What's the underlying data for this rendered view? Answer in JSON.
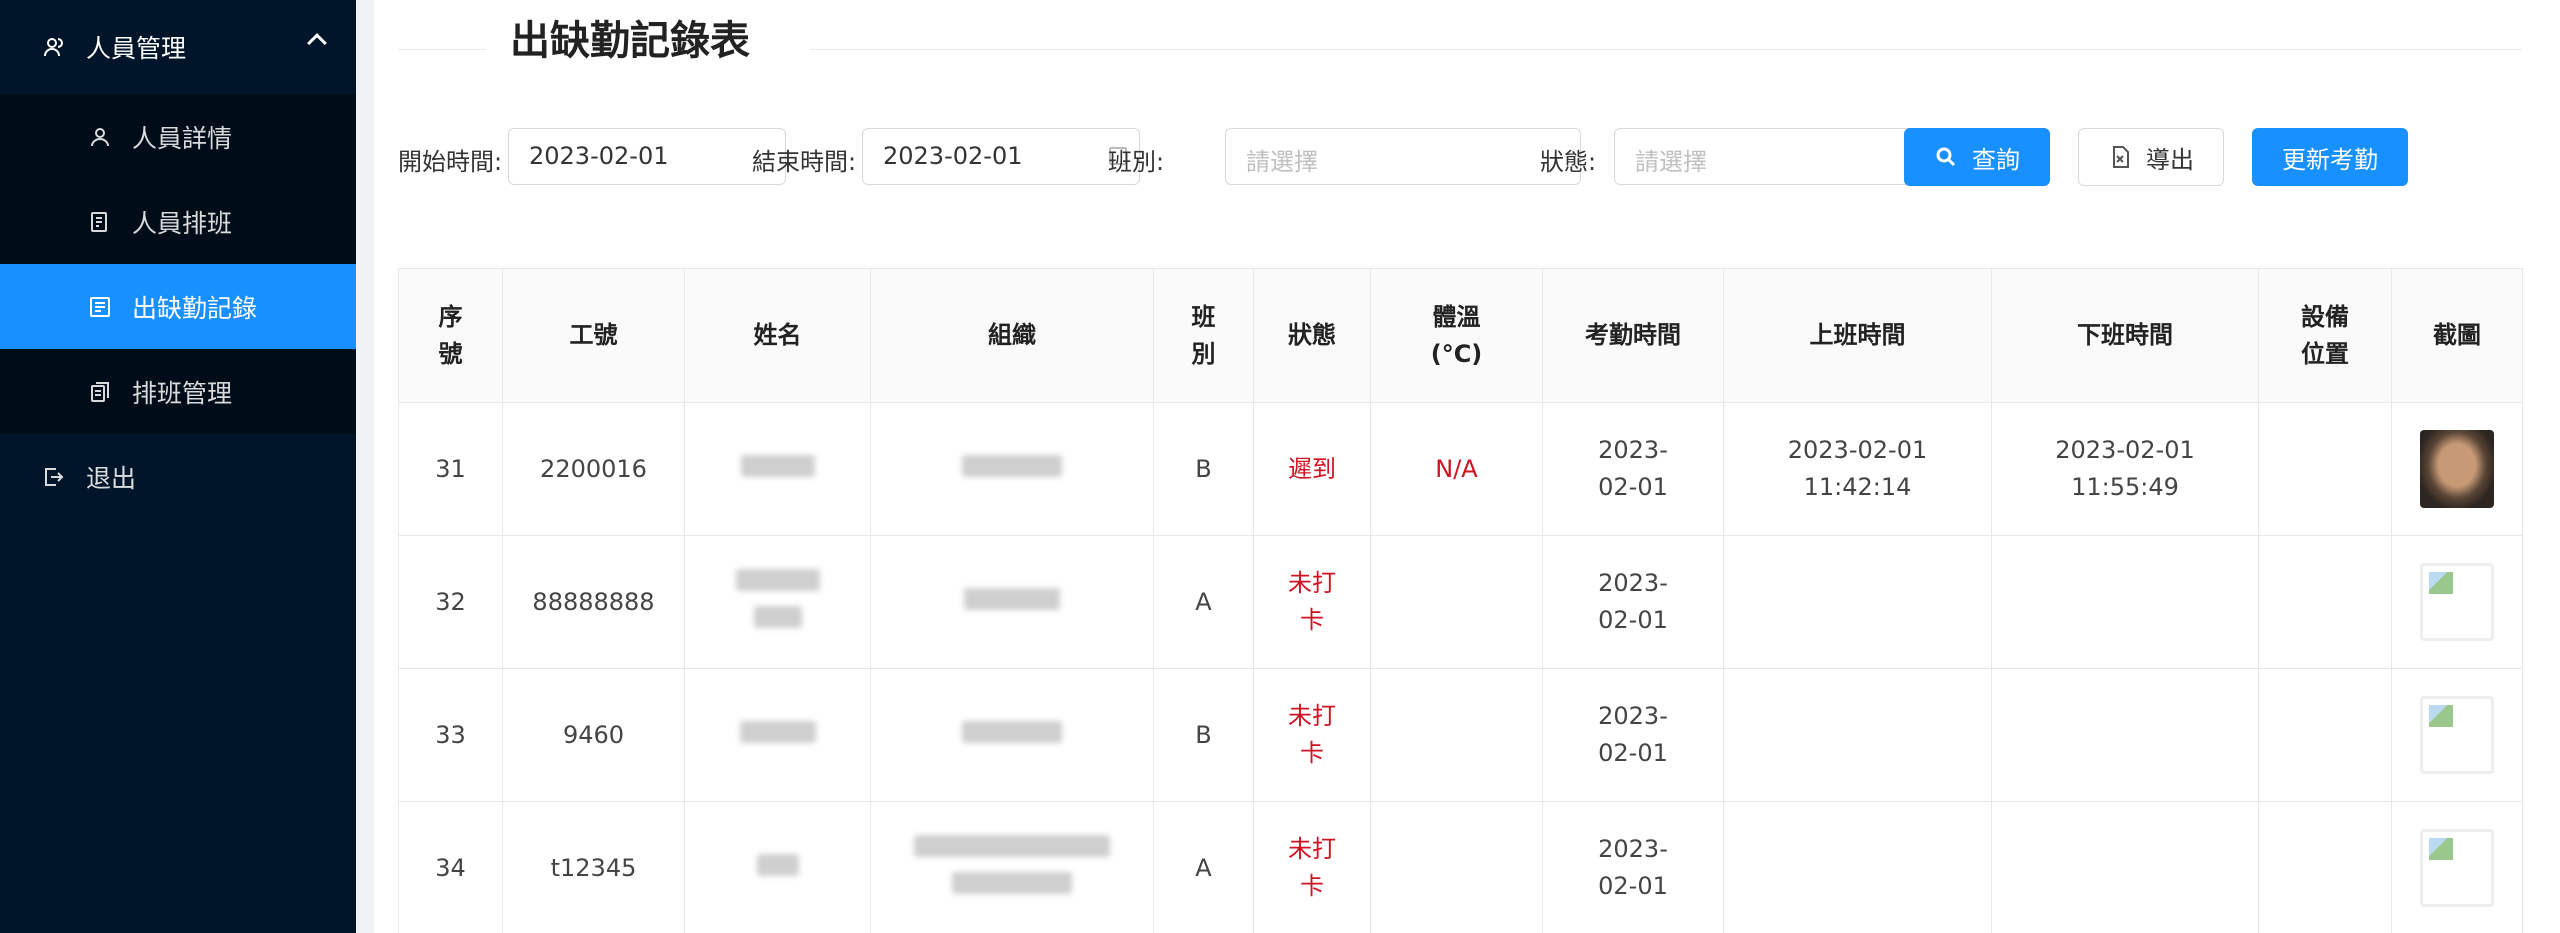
{
  "sidebar": {
    "group_label": "人員管理",
    "items": [
      {
        "label": "人員詳情",
        "icon": "user-icon",
        "active": false
      },
      {
        "label": "人員排班",
        "icon": "schedule-doc-icon",
        "active": false
      },
      {
        "label": "出缺勤記錄",
        "icon": "attendance-list-icon",
        "active": true
      },
      {
        "label": "排班管理",
        "icon": "shift-manage-icon",
        "active": false
      }
    ],
    "logout_label": "退出"
  },
  "page": {
    "title": "出缺勤記錄表"
  },
  "filters": {
    "start_label": "開始時間:",
    "start_value": "2023-02-01",
    "end_label": "結束時間:",
    "end_value": "2023-02-01",
    "shift_label": "班別:",
    "shift_placeholder": "請選擇",
    "status_label": "狀態:",
    "status_placeholder": "請選擇",
    "search_label": "查詢",
    "export_label": "導出",
    "update_label": "更新考勤"
  },
  "table": {
    "headers": [
      "序號",
      "工號",
      "姓名",
      "組織",
      "班別",
      "狀態",
      "體溫(°C)",
      "考勤時間",
      "上班時間",
      "下班時間",
      "設備位置",
      "截圖"
    ],
    "rows": [
      {
        "seq": "31",
        "emp_id": "2200016",
        "shift": "B",
        "status": "遲到",
        "temp": "N/A",
        "att_date": "2023-02-01",
        "clock_in": "2023-02-01 11:42:14",
        "clock_out": "2023-02-01 11:55:49",
        "device": ""
      },
      {
        "seq": "32",
        "emp_id": "88888888",
        "shift": "A",
        "status": "未打卡",
        "temp": "",
        "att_date": "2023-02-01",
        "clock_in": "",
        "clock_out": "",
        "device": ""
      },
      {
        "seq": "33",
        "emp_id": "9460",
        "shift": "B",
        "status": "未打卡",
        "temp": "",
        "att_date": "2023-02-01",
        "clock_in": "",
        "clock_out": "",
        "device": ""
      },
      {
        "seq": "34",
        "emp_id": "t12345",
        "shift": "A",
        "status": "未打卡",
        "temp": "",
        "att_date": "2023-02-01",
        "clock_in": "",
        "clock_out": "",
        "device": ""
      }
    ]
  },
  "colors": {
    "sidebar_bg": "#001529",
    "accent": "#1890ff",
    "status_red": "#cf1322"
  }
}
